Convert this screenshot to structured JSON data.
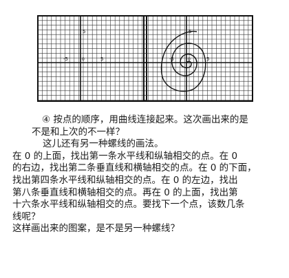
{
  "figures": {
    "left": {
      "axis_labels": {
        "top": "5",
        "left": "-5",
        "right": "5",
        "origin": "0"
      }
    },
    "right": {
      "axis_labels": {
        "top": "5",
        "left": "-5",
        "right": "5",
        "origin": "0"
      }
    }
  },
  "text": {
    "lines": [
      "④ 按点的顺序，用曲线连接起来。这次画出来的是",
      "不是和上次的不一样？",
      "这儿还有另一种螺线的画法。",
      "在 0 的上面，找出第一条水平线和纵轴相交的点。在 0",
      "的右边，找出第二条垂直线和横轴相交的点。在 0 的下面，",
      "找出第四条水平线和纵轴相交的点。在 0 的左边，找出",
      "第八条垂直线和横轴相交的点。再在 0 的上面，找出第",
      "十六条水平线和纵轴相交的点。要找下一个点，该数几条",
      "线呢？",
      "这样画出来的图案，是不是另一种螺线？"
    ]
  }
}
